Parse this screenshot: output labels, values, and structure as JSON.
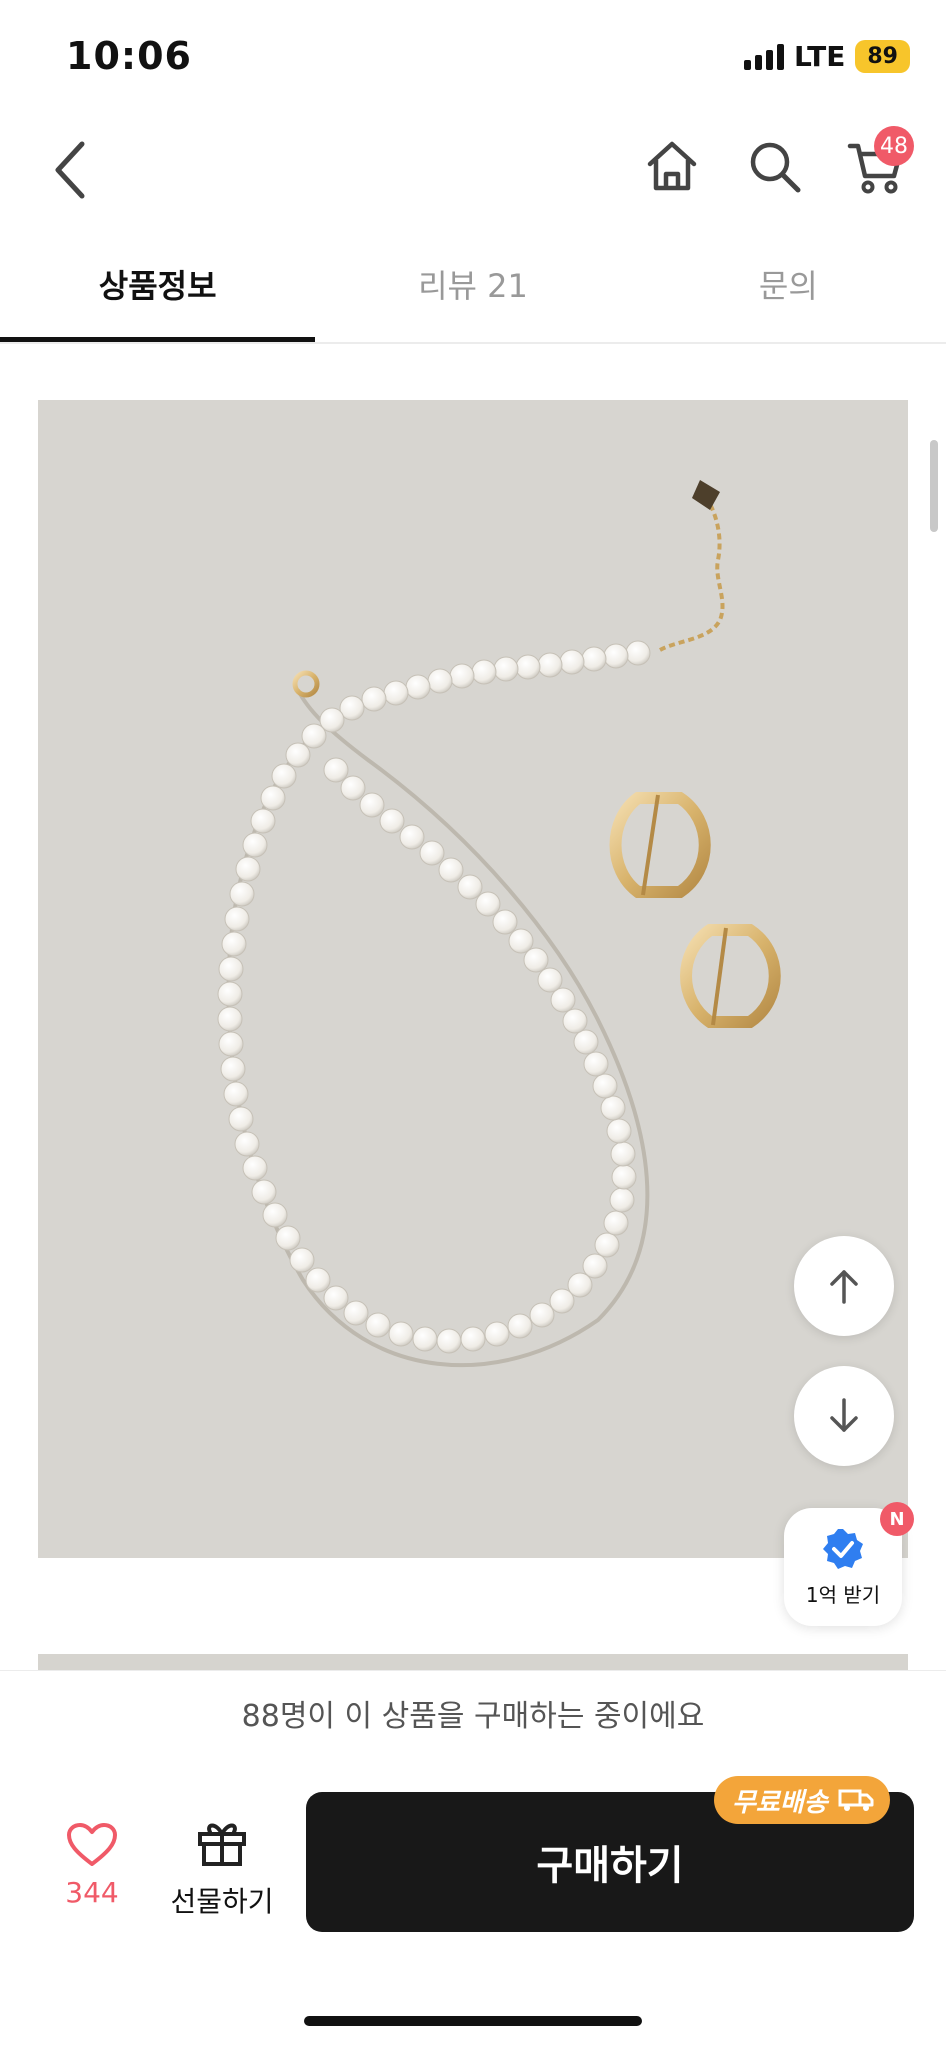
{
  "status": {
    "time": "10:06",
    "network": "LTE",
    "battery": "89"
  },
  "header": {
    "cart_count": "48"
  },
  "tabs": [
    {
      "label": "상품정보",
      "active": true
    },
    {
      "label": "리뷰 21",
      "active": false
    },
    {
      "label": "문의",
      "active": false
    }
  ],
  "product_image": {
    "icon": "pearl-necklace-photo"
  },
  "reward": {
    "label": "1억 받기",
    "badge": "N"
  },
  "banner": {
    "text": "88명이 이 상품을 구매하는 중이에요"
  },
  "bottom_bar": {
    "like_count": "344",
    "gift_label": "선물하기",
    "buy_label": "구매하기",
    "shipping_badge": "무료배송"
  },
  "colors": {
    "accent": "#f05a68",
    "buy_button": "#181818",
    "shipping": "#f3a53a",
    "battery": "#f7c52b"
  }
}
